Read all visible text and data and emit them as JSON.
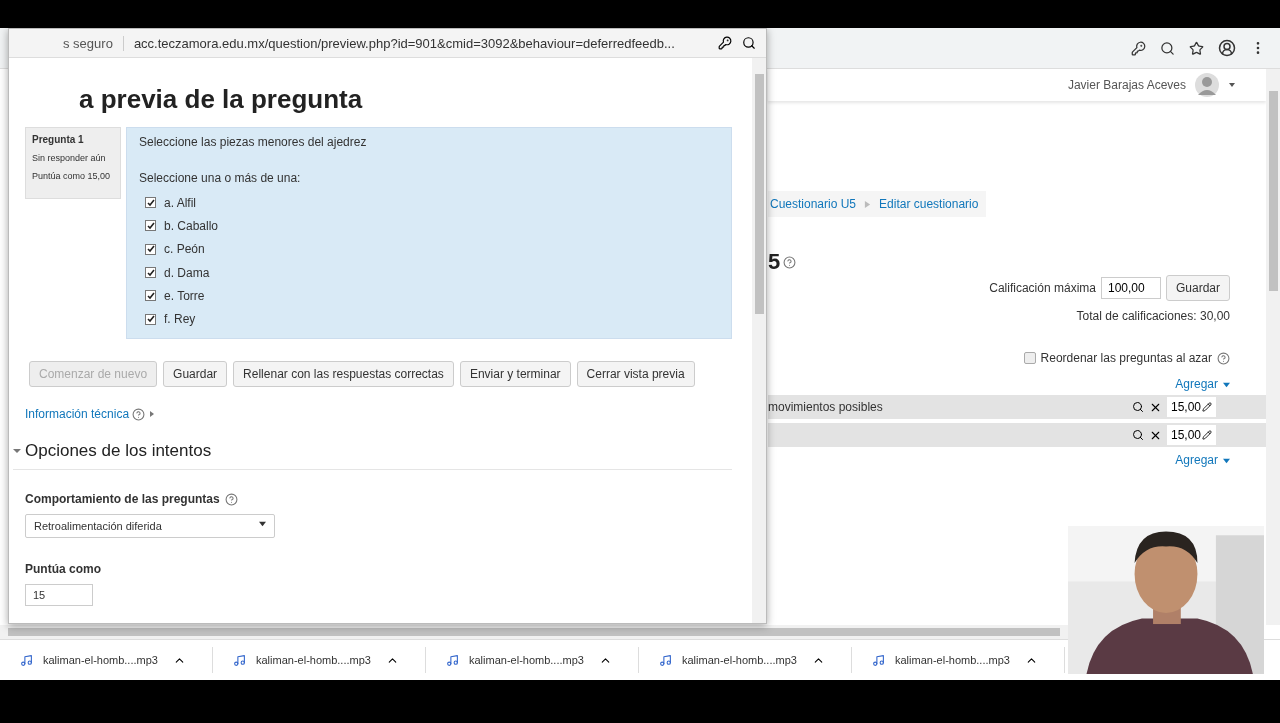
{
  "back_browser": {
    "user": {
      "name": "Javier Barajas Aceves"
    },
    "breadcrumb": [
      {
        "label": "Cuestionario U5"
      },
      {
        "label": "Editar cuestionario"
      }
    ],
    "heading": "5",
    "max_grade": {
      "label": "Calificación máxima",
      "value": "100,00",
      "button": "Guardar"
    },
    "total": "Total de calificaciones: 30,00",
    "shuffle": {
      "label": "Reordenar las preguntas al azar",
      "checked": false
    },
    "add_links": [
      "Agregar",
      "Agregar"
    ],
    "questions": [
      {
        "name": "movimientos posibles",
        "mark": "15,00"
      },
      {
        "mark": "15,00"
      }
    ],
    "downloads": [
      "kaliman-el-homb....mp3",
      "kaliman-el-homb....mp3",
      "kaliman-el-homb....mp3",
      "kaliman-el-homb....mp3",
      "kaliman-el-homb....mp3"
    ]
  },
  "popup": {
    "security": "s seguro",
    "url": "acc.teczamora.edu.mx/question/preview.php?id=901&cmid=3092&behaviour=deferredfeedb...",
    "title": "a previa de la pregunta",
    "info": {
      "number": "Pregunta 1",
      "status": "Sin responder aún",
      "points": "Puntúa como 15,00"
    },
    "question": {
      "text": "Seleccione las piezas menores del ajedrez",
      "prompt": "Seleccione una o más de una:",
      "options": [
        {
          "label": "a. Alfil",
          "checked": true
        },
        {
          "label": "b. Caballo",
          "checked": true
        },
        {
          "label": "c. Peón",
          "checked": true
        },
        {
          "label": "d. Dama",
          "checked": true
        },
        {
          "label": "e. Torre",
          "checked": true
        },
        {
          "label": "f. Rey",
          "checked": true
        }
      ]
    },
    "buttons": [
      {
        "label": "Comenzar de nuevo",
        "disabled": true
      },
      {
        "label": "Guardar",
        "disabled": false
      },
      {
        "label": "Rellenar con las respuestas correctas",
        "disabled": false
      },
      {
        "label": "Enviar y terminar",
        "disabled": false
      },
      {
        "label": "Cerrar vista previa",
        "disabled": false
      }
    ],
    "tech_info": "Información técnica",
    "section": {
      "title": "Opciones de los intentos",
      "expanded": true
    },
    "behaviour": {
      "label": "Comportamiento de las preguntas",
      "value": "Retroalimentación diferida"
    },
    "mark_as": {
      "label": "Puntúa como",
      "value": "15"
    }
  }
}
